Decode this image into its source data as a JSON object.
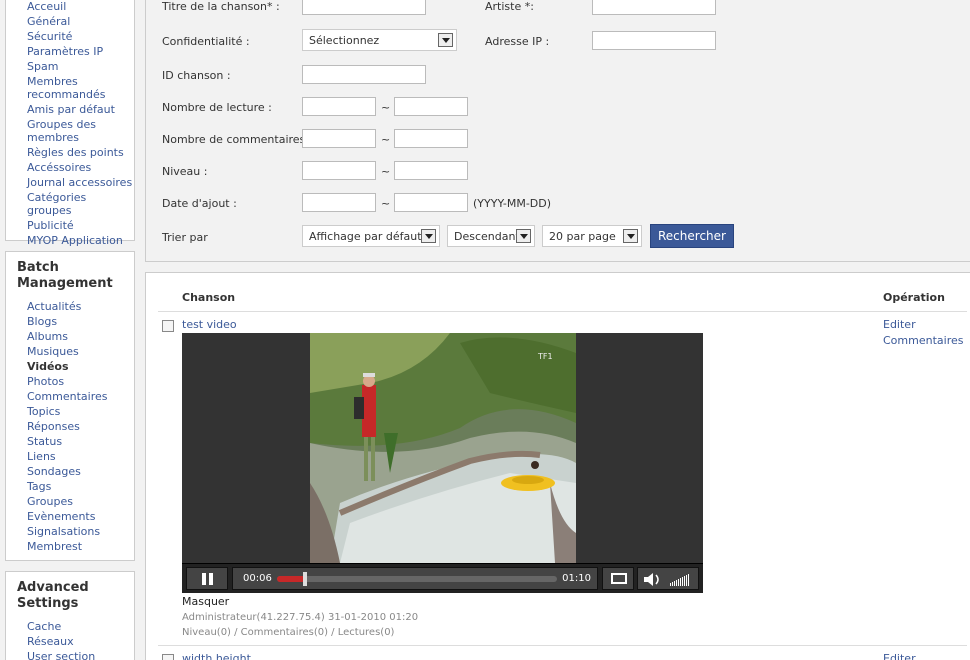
{
  "sidebar": {
    "top_items": [
      "Acceuil",
      "Général",
      "Sécurité",
      "Paramètres IP",
      "Spam",
      "Membres recommandés",
      "Amis par défaut",
      "Groupes des membres",
      "Règles des points",
      "Accéssoires",
      "Journal accessoires",
      "Catégories groupes",
      "Publicité",
      "MYOP Application"
    ],
    "batch_title": "Batch Management",
    "batch_items": [
      "Actualités",
      "Blogs",
      "Albums",
      "Musiques",
      "Vidéos",
      "Photos",
      "Commentaires",
      "Topics",
      "Réponses",
      "Status",
      "Liens",
      "Sondages",
      "Tags",
      "Groupes",
      "Evènements",
      "Signalsations",
      "Membrest"
    ],
    "batch_active": "Vidéos",
    "adv_title": "Advanced Settings",
    "adv_items": [
      "Cache",
      "Réseaux",
      "User section"
    ]
  },
  "search": {
    "title_label": "Titre de la chanson* :",
    "artist_label": "Artiste *:",
    "privacy_label": "Confidentialité :",
    "privacy_value": "Sélectionnez",
    "ip_label": "Adresse IP :",
    "id_label": "ID chanson :",
    "plays_label": "Nombre de lecture :",
    "comments_label": "Nombre de commentaires :",
    "level_label": "Niveau :",
    "date_label": "Date d'ajout :",
    "date_hint": "(YYYY-MM-DD)",
    "tilde": "~",
    "sort_label": "Trier par",
    "sort_value": "Affichage par défaut :",
    "order_value": "Descendant",
    "perpage_value": "20 par page",
    "submit_label": "Rechercher"
  },
  "results": {
    "col_song": "Chanson",
    "col_op": "Opération",
    "item1": {
      "title": "test video",
      "op_edit": "Editer",
      "op_comments": "Commentaires",
      "time_current": "00:06",
      "time_total": "01:10",
      "progress": 0.1,
      "hide_label": "Masquer",
      "meta_line": "Administrateur(41.227.75.4)  31-01-2010 01:20",
      "stats_line": "Niveau(0) / Commentaires(0) / Lectures(0)"
    },
    "item2": {
      "title": "width height",
      "op_edit": "Editer"
    }
  }
}
